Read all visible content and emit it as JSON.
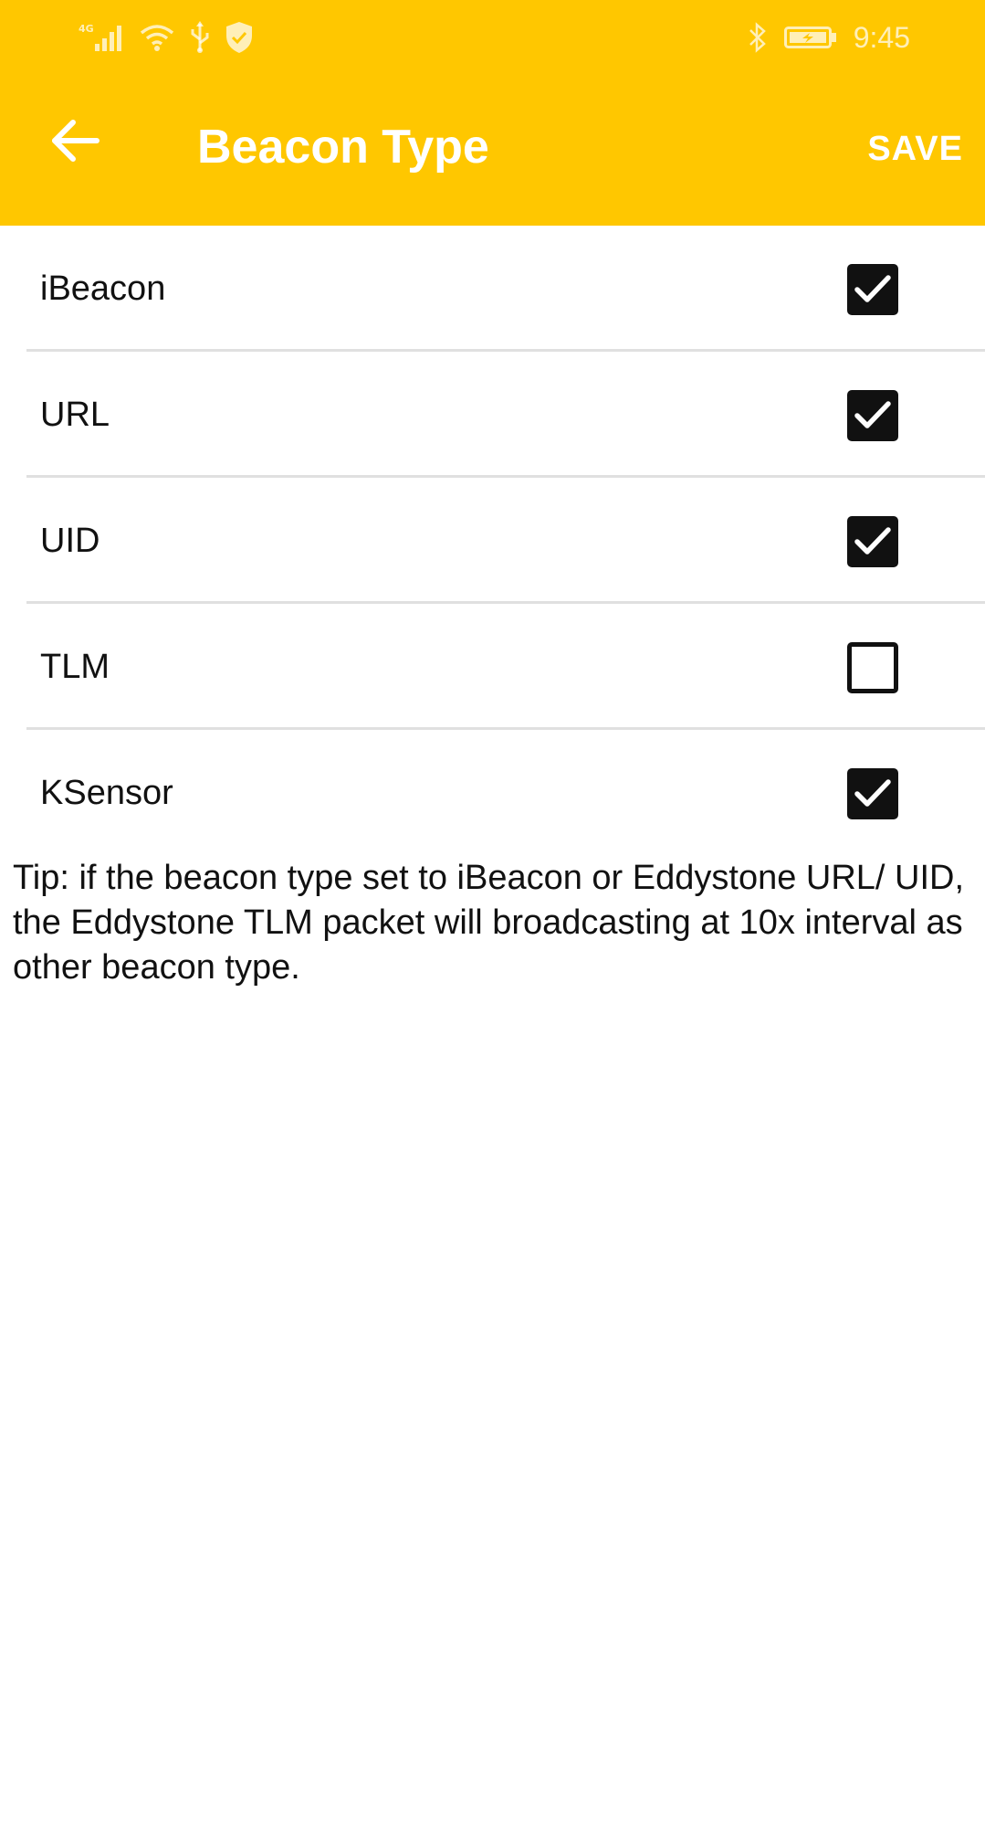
{
  "status_bar": {
    "time": "9:45",
    "icons": [
      "signal-4g-icon",
      "wifi-icon",
      "usb-icon",
      "shield-icon",
      "bluetooth-icon",
      "battery-charging-icon"
    ]
  },
  "toolbar": {
    "title": "Beacon Type",
    "save_label": "SAVE",
    "back_icon": "arrow-left-icon",
    "background_color": "#ffc700"
  },
  "beacon_types": [
    {
      "label": "iBeacon",
      "checked": true
    },
    {
      "label": "URL",
      "checked": true
    },
    {
      "label": "UID",
      "checked": true
    },
    {
      "label": "TLM",
      "checked": false
    },
    {
      "label": "KSensor",
      "checked": true
    }
  ],
  "tip": "Tip: if the beacon type set to iBeacon or Eddystone URL/ UID, the Eddystone TLM packet will broadcasting at 10x interval as other beacon type."
}
